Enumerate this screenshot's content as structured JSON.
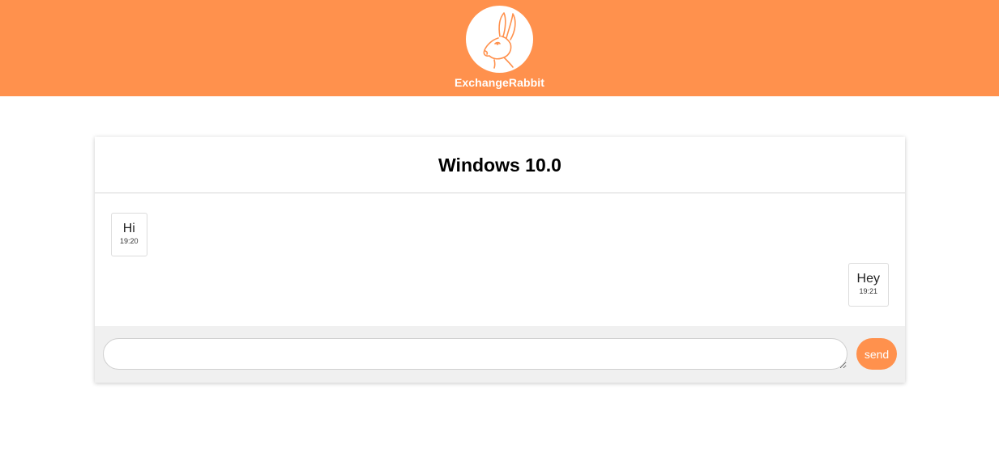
{
  "brand": {
    "name": "ExchangeRabbit",
    "logo_icon": "rabbit-head-icon",
    "header_color": "#ff914d"
  },
  "chat": {
    "title": "Windows 10.0",
    "messages": [
      {
        "side": "left",
        "text": "Hi",
        "time": "19:20"
      },
      {
        "side": "right",
        "text": "Hey",
        "time": "19:21"
      }
    ]
  },
  "composer": {
    "input_value": "",
    "send_label": "send",
    "accent_color": "#ff914d"
  }
}
